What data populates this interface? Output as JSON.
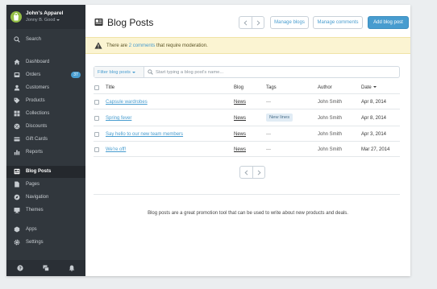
{
  "store": {
    "name": "John's Apparel",
    "user": "Jonny B. Good"
  },
  "sidebar": {
    "search_label": "Search",
    "items": [
      {
        "label": "Dashboard",
        "icon": "home-icon"
      },
      {
        "label": "Orders",
        "icon": "inbox-icon",
        "badge": "37"
      },
      {
        "label": "Customers",
        "icon": "customers-icon"
      },
      {
        "label": "Products",
        "icon": "tag-icon"
      },
      {
        "label": "Collections",
        "icon": "collections-icon"
      },
      {
        "label": "Discounts",
        "icon": "discount-icon"
      },
      {
        "label": "Gift Cards",
        "icon": "gift-card-icon"
      },
      {
        "label": "Reports",
        "icon": "reports-icon"
      },
      {
        "label": "Blog Posts",
        "icon": "blog-icon",
        "active": true
      },
      {
        "label": "Pages",
        "icon": "pages-icon"
      },
      {
        "label": "Navigation",
        "icon": "navigation-icon"
      },
      {
        "label": "Themes",
        "icon": "themes-icon"
      },
      {
        "label": "Apps",
        "icon": "apps-icon"
      },
      {
        "label": "Settings",
        "icon": "gear-icon"
      }
    ],
    "footer_icons": [
      "help-icon",
      "chat-icon",
      "bell-icon"
    ]
  },
  "header": {
    "title": "Blog Posts",
    "manage_blogs": "Manage blogs",
    "manage_comments": "Manage comments",
    "add_post": "Add blog post"
  },
  "alert": {
    "prefix": "There are ",
    "link": "2 comments",
    "suffix": " that require moderation."
  },
  "filter": {
    "button_label": "Filter blog posts",
    "placeholder": "Start typing a blog post's name..."
  },
  "table": {
    "columns": [
      "Title",
      "Blog",
      "Tags",
      "Author",
      "Date"
    ],
    "rows": [
      {
        "title": "Capsule wardrobes",
        "blog": "News",
        "tags": "—",
        "author": "John Smith",
        "date": "Apr 8, 2014"
      },
      {
        "title": "Spring fever",
        "blog": "News",
        "tags": "New lines",
        "author": "John Smith",
        "date": "Apr 8, 2014"
      },
      {
        "title": "Say hello to our new team members",
        "blog": "News",
        "tags": "—",
        "author": "John Smith",
        "date": "Apr 3, 2014"
      },
      {
        "title": "We're off!",
        "blog": "News",
        "tags": "—",
        "author": "John Smith",
        "date": "Mar 27, 2014"
      }
    ]
  },
  "footer_note": "Blog posts are a great promotion tool that can be used to write about new products and deals.",
  "colors": {
    "sidebar_bg": "#31373d",
    "accent": "#479ccf",
    "alert_bg": "#fbf4d2",
    "logo_green": "#95bf47"
  }
}
